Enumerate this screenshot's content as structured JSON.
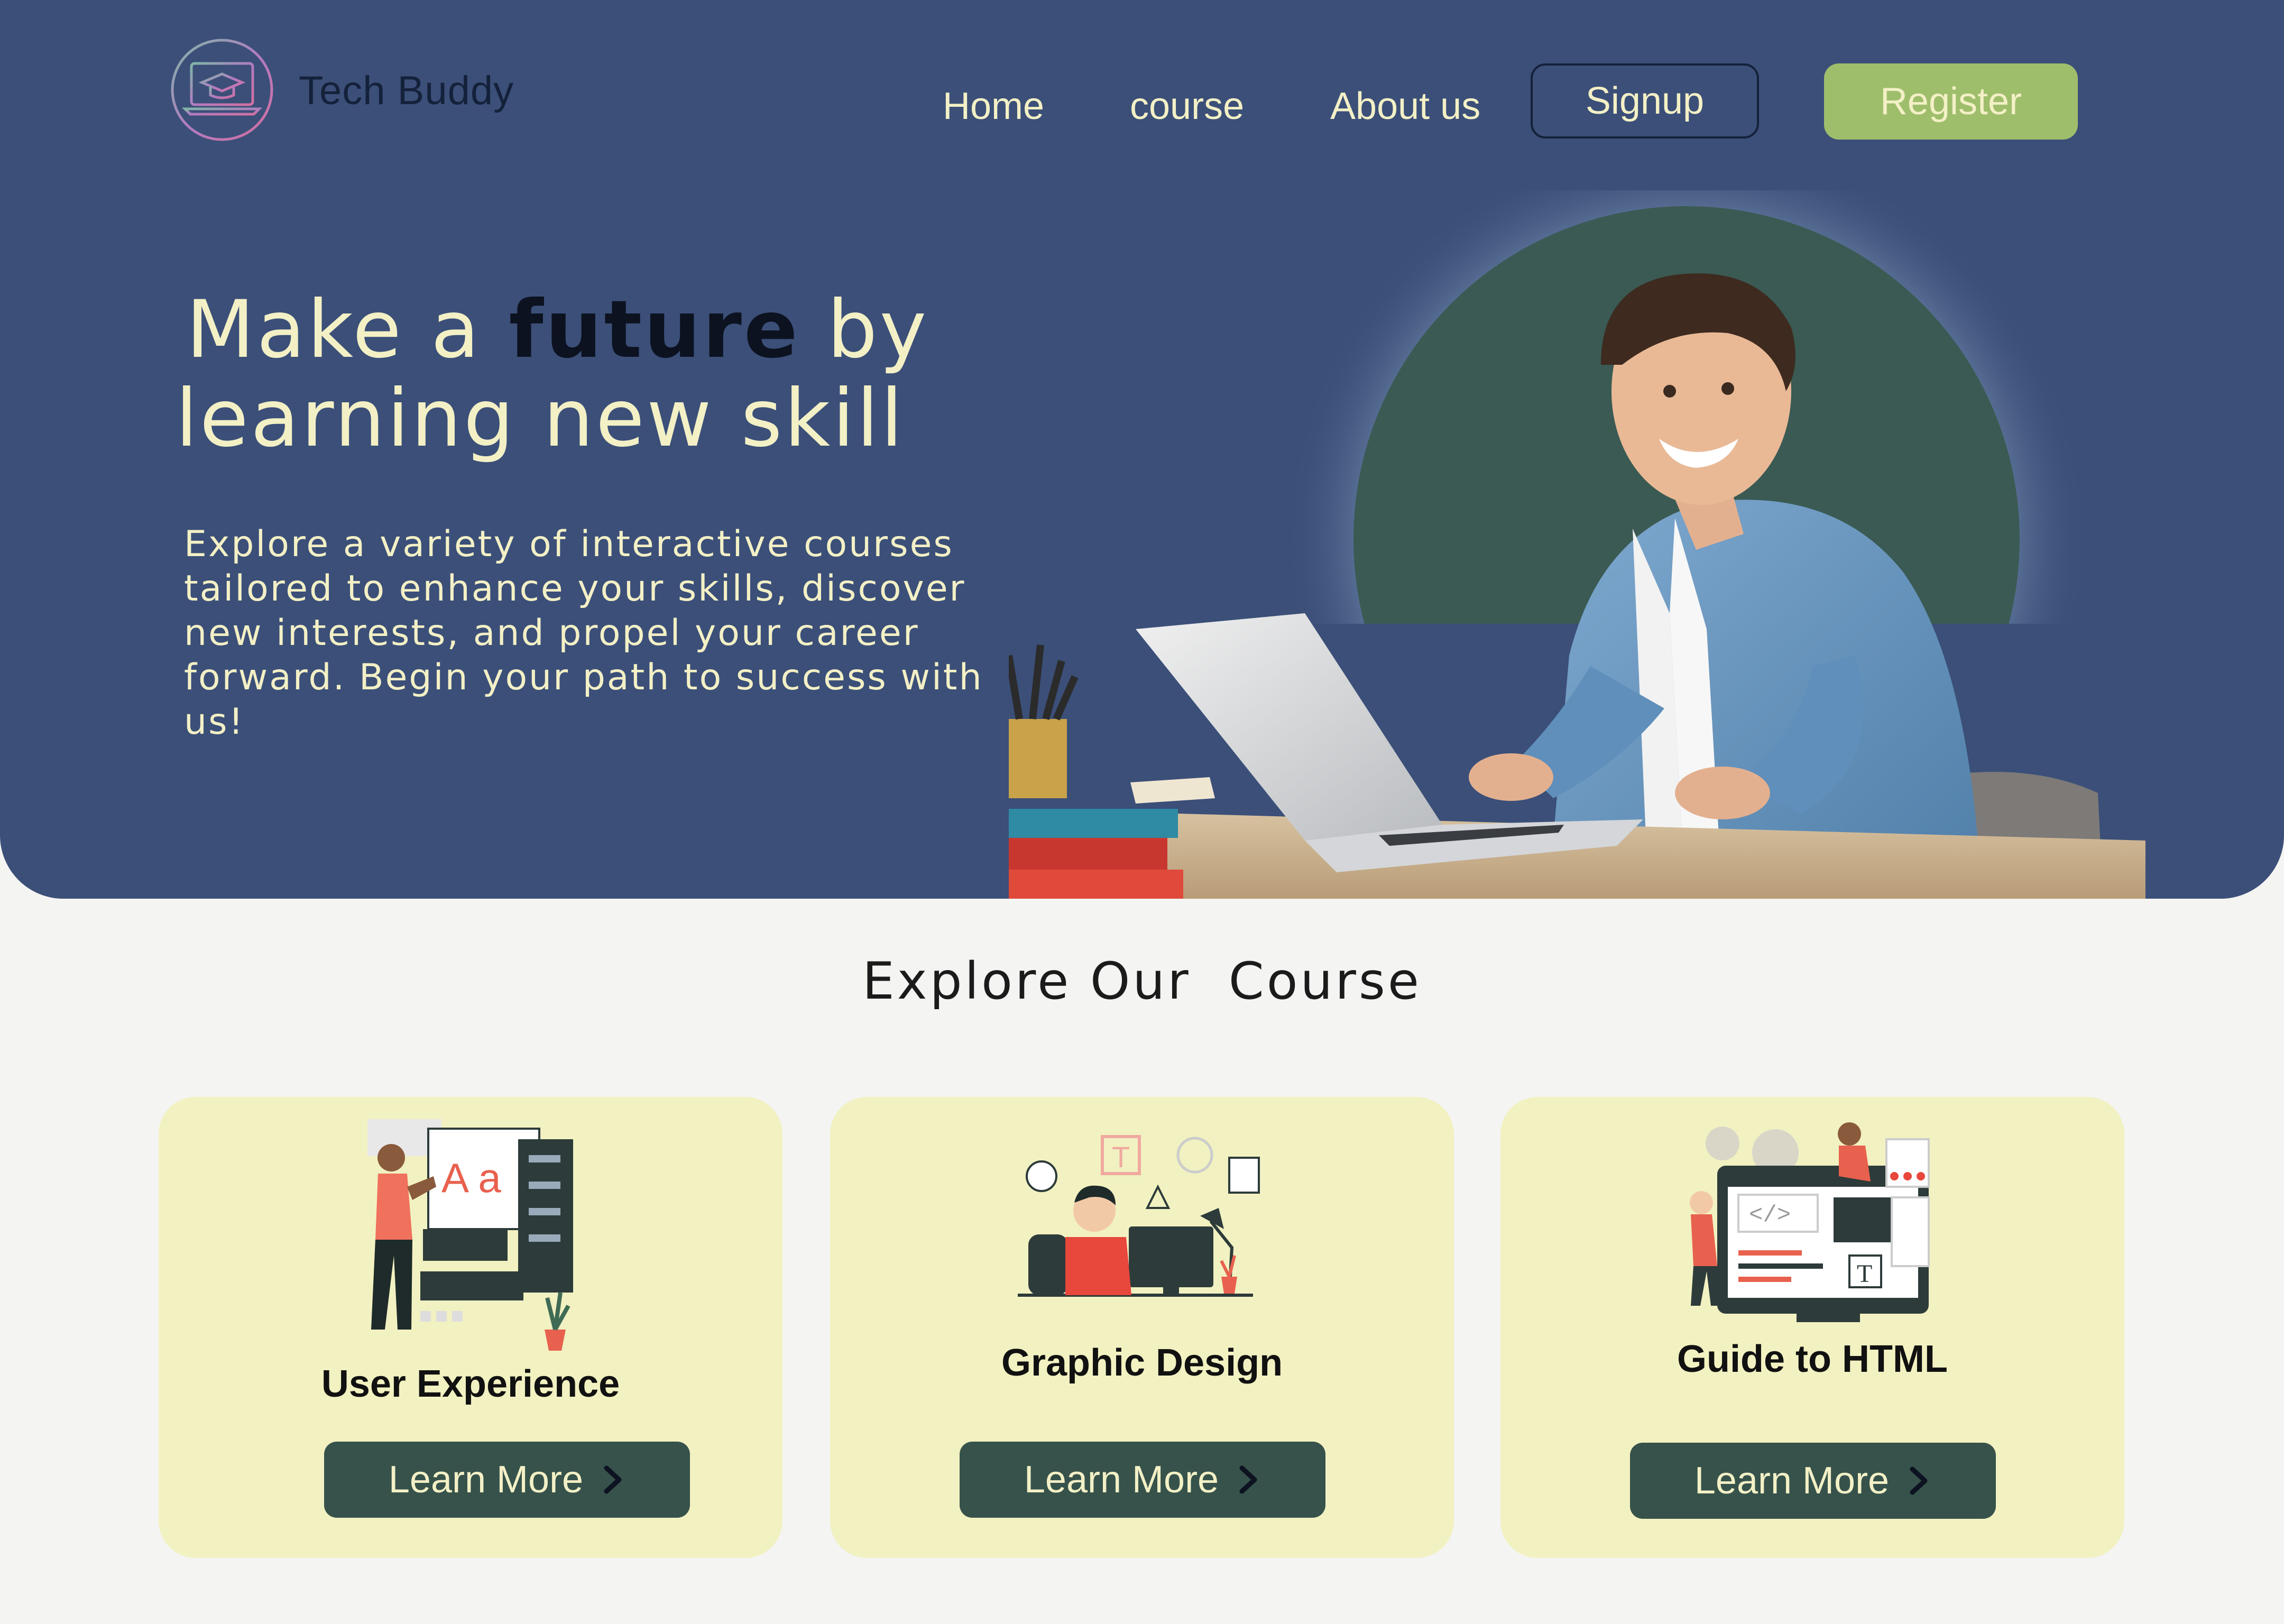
{
  "brand": {
    "name": "Tech Buddy",
    "logo_icon": "graduation-cap-laptop-icon"
  },
  "nav": {
    "links": [
      "Home",
      "course",
      "About us"
    ],
    "signup_label": "Signup",
    "register_label": "Register"
  },
  "hero": {
    "headline_part1": "Make a ",
    "headline_strong": "future",
    "headline_part2": " by",
    "headline_line2": "learning new skill",
    "description": "Explore a variety of interactive courses tailored to enhance your skills, discover new interests, and propel your career forward. Begin your path to success with us!",
    "image_icon": "student-with-laptop-photo"
  },
  "courses": {
    "section_title": "Explore Our  Course",
    "items": [
      {
        "title": "User Experience",
        "button_label": "Learn More",
        "illustration": "ux-designer-illustration"
      },
      {
        "title": "Graphic Design",
        "button_label": "Learn More",
        "illustration": "graphic-designer-desk-illustration"
      },
      {
        "title": "Guide to HTML",
        "button_label": "Learn More",
        "illustration": "html-coding-illustration"
      }
    ]
  },
  "colors": {
    "hero_bg": "#3b4f78",
    "cream_text": "#f3f0c6",
    "register_bg": "#9fbe6c",
    "card_bg": "#f2f1c1",
    "button_bg": "#36524b",
    "page_bg": "#f4f4f2"
  }
}
